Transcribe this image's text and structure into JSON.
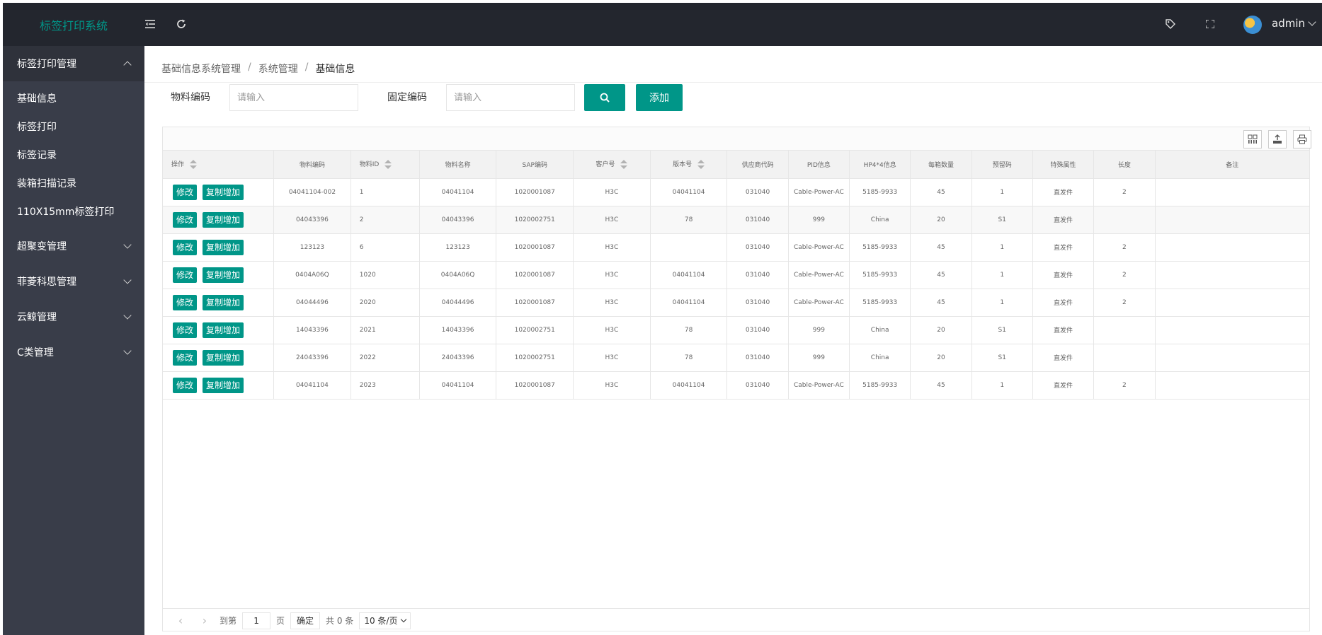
{
  "app": {
    "title": "标签打印系统",
    "user": "admin"
  },
  "header": {
    "menu_toggle_icon": "menu-fold-icon",
    "refresh_icon": "refresh-icon",
    "tag_icon": "tag-icon",
    "fullscreen_icon": "fullscreen-icon"
  },
  "sidebar": {
    "groups": [
      {
        "label": "标签打印管理",
        "open": true,
        "items": [
          "基础信息",
          "标签打印",
          "标签记录",
          "装箱扫描记录",
          "110X15mm标签打印"
        ]
      },
      {
        "label": "超聚变管理",
        "open": false
      },
      {
        "label": "菲菱科思管理",
        "open": false
      },
      {
        "label": "云鲸管理",
        "open": false
      },
      {
        "label": "C类管理",
        "open": false
      }
    ]
  },
  "breadcrumb": [
    "基础信息系统管理",
    "系统管理",
    "基础信息"
  ],
  "search": {
    "material_code_label": "物料编码",
    "material_code_placeholder": "请输入",
    "fixed_code_label": "固定编码",
    "fixed_code_placeholder": "请输入",
    "add_label": "添加"
  },
  "table": {
    "columns": [
      "操作",
      "物料编码",
      "物料ID",
      "物料名称",
      "SAP编码",
      "客户号",
      "版本号",
      "供应商代码",
      "PID信息",
      "HP4*4信息",
      "每箱数量",
      "预留码",
      "特殊属性",
      "长度",
      "备注"
    ],
    "edit_label": "修改",
    "copy_label": "复制增加",
    "rows": [
      [
        "04041104-002",
        "1",
        "04041104",
        "1020001087",
        "H3C",
        "04041104",
        "031040",
        "Cable-Power-AC",
        "5185-9933",
        "45",
        "1",
        "直发件",
        "2",
        ""
      ],
      [
        "04043396",
        "2",
        "04043396",
        "1020002751",
        "H3C",
        "78",
        "031040",
        "999",
        "China",
        "20",
        "S1",
        "直发件",
        "",
        ""
      ],
      [
        "123123",
        "6",
        "123123",
        "1020001087",
        "H3C",
        "",
        "031040",
        "Cable-Power-AC",
        "5185-9933",
        "45",
        "1",
        "直发件",
        "2",
        ""
      ],
      [
        "0404A06Q",
        "1020",
        "0404A06Q",
        "1020001087",
        "H3C",
        "04041104",
        "031040",
        "Cable-Power-AC",
        "5185-9933",
        "45",
        "1",
        "直发件",
        "2",
        ""
      ],
      [
        "04044496",
        "2020",
        "04044496",
        "1020001087",
        "H3C",
        "04041104",
        "031040",
        "Cable-Power-AC",
        "5185-9933",
        "45",
        "1",
        "直发件",
        "2",
        ""
      ],
      [
        "14043396",
        "2021",
        "14043396",
        "1020002751",
        "H3C",
        "78",
        "031040",
        "999",
        "China",
        "20",
        "S1",
        "直发件",
        "",
        ""
      ],
      [
        "24043396",
        "2022",
        "24043396",
        "1020002751",
        "H3C",
        "78",
        "031040",
        "999",
        "China",
        "20",
        "S1",
        "直发件",
        "",
        ""
      ],
      [
        "04041104",
        "2023",
        "04041104",
        "1020001087",
        "H3C",
        "04041104",
        "031040",
        "Cable-Power-AC",
        "5185-9933",
        "45",
        "1",
        "直发件",
        "2",
        ""
      ]
    ]
  },
  "pager": {
    "goto_label": "到第",
    "page_value": "1",
    "page_unit": "页",
    "confirm_label": "确定",
    "total_label": "共 0 条",
    "page_size": "10 条/页"
  },
  "colors": {
    "accent": "#009688",
    "header_bg": "#23262e",
    "sidebar_bg": "#393d49"
  }
}
